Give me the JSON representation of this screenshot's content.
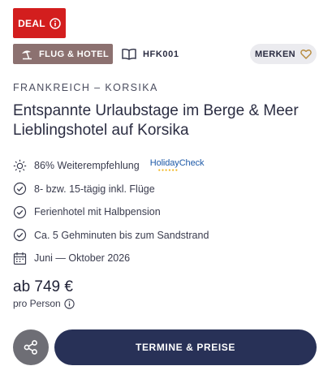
{
  "badges": {
    "deal_label": "DEAL",
    "type_label": "FLUG & HOTEL",
    "code": "HFK001",
    "merken_label": "MERKEN"
  },
  "offer": {
    "region": "FRANKREICH – KORSIKA",
    "title_line1": "Entspannte Urlaubstage im Berge & Meer",
    "title_line2": "Lieblingshotel auf Korsika"
  },
  "features": [
    {
      "icon": "sun-icon",
      "text": "86% Weiterempfehlung"
    },
    {
      "icon": "check-circle-icon",
      "text": "8- bzw. 15-tägig inkl. Flüge"
    },
    {
      "icon": "check-circle-icon",
      "text": "Ferienhotel mit Halbpension"
    },
    {
      "icon": "check-circle-icon",
      "text": "Ca. 5 Gehminuten bis zum Sandstrand"
    },
    {
      "icon": "calendar-icon",
      "text": "Juni — Oktober 2026"
    }
  ],
  "holidaycheck": {
    "name": "HolidayCheck",
    "stars": 6
  },
  "pricing": {
    "price": "ab 749 €",
    "per_person": "pro Person"
  },
  "actions": {
    "cta_label": "TERMINE & PREISE"
  },
  "colors": {
    "deal_red": "#d31e1e",
    "type_badge": "#8c7170",
    "cta_navy": "#283157",
    "share_gray": "#6e6e75",
    "holidaycheck_blue": "#1e5aa8"
  }
}
